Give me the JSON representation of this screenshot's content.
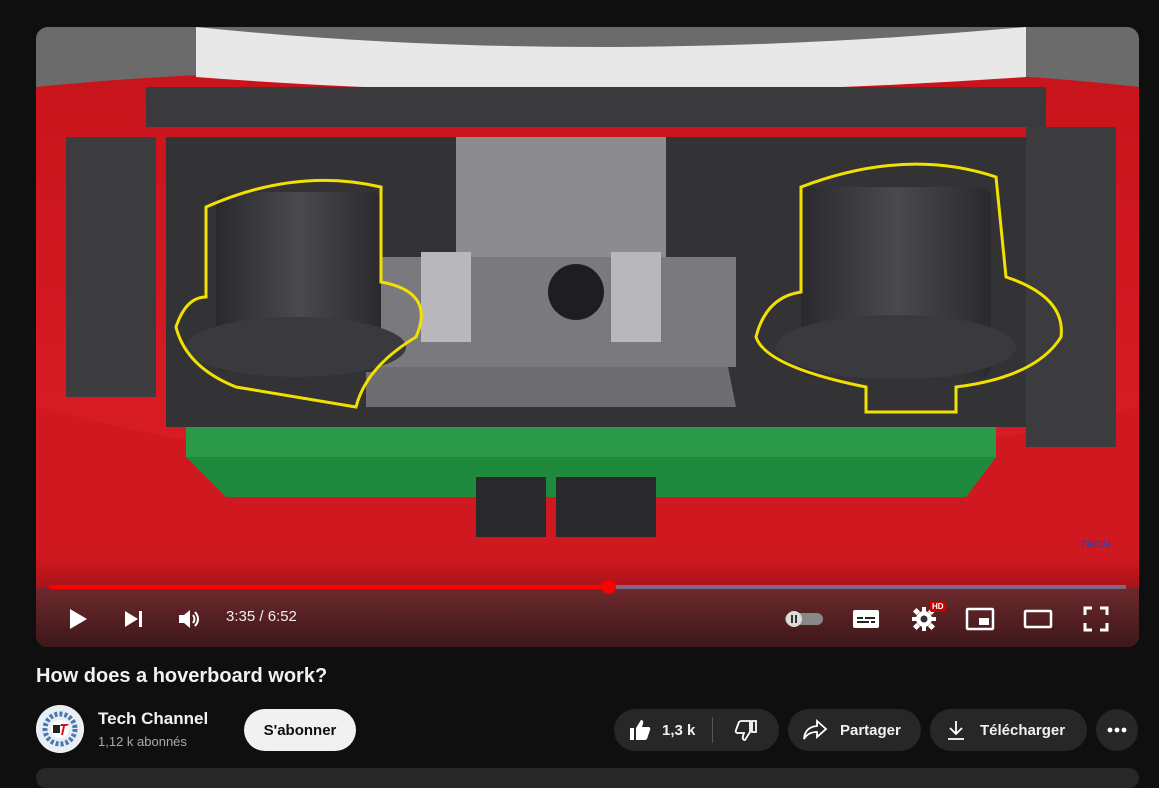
{
  "video": {
    "time_display": "3:35 / 6:52",
    "progress_fraction": 0.52,
    "buffer_fraction": 0.52,
    "hd_badge": "HD",
    "watermark": "TECH",
    "title": "How does a hoverboard work?"
  },
  "controls": {
    "play_icon": "play-icon",
    "next_icon": "next-icon",
    "volume_icon": "volume-icon",
    "autoplay_icon": "autoplay-toggle-icon",
    "captions_icon": "subtitles-icon",
    "settings_icon": "gear-icon",
    "miniplayer_icon": "miniplayer-icon",
    "theater_icon": "theater-mode-icon",
    "fullscreen_icon": "fullscreen-icon"
  },
  "channel": {
    "name": "Tech Channel",
    "subscribers": "1,12 k abonnés",
    "subscribe_label": "S'abonner"
  },
  "actions": {
    "like_count": "1,3 k",
    "share_label": "Partager",
    "download_label": "Télécharger"
  },
  "colors": {
    "accent": "#ff0000",
    "background": "#0f0f0f",
    "pill": "#272727"
  }
}
